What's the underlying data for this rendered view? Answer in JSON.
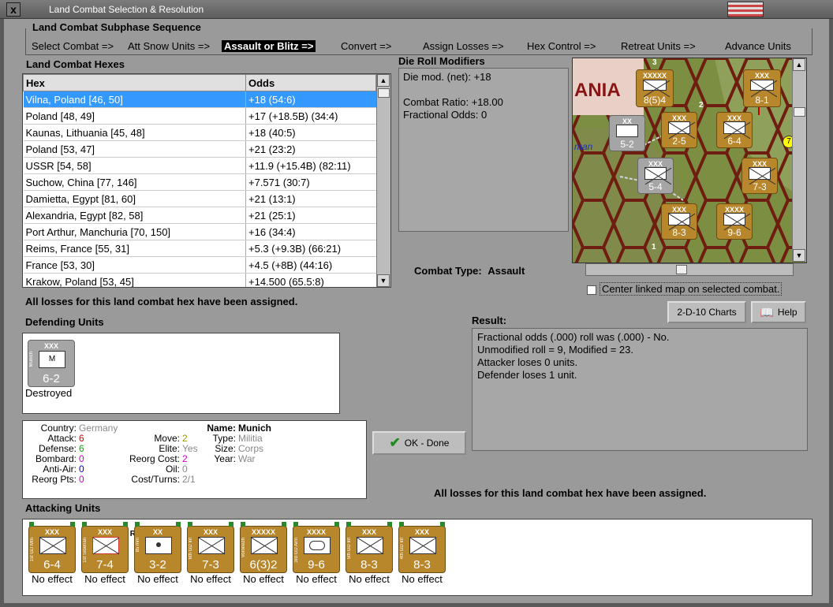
{
  "window": {
    "title": "Land Combat Selection & Resolution",
    "close_label": "x"
  },
  "sequence": {
    "label": "Land Combat Subphase Sequence",
    "steps": [
      "Select Combat =>",
      "Att Snow Units =>",
      "Assault or Blitz =>",
      "Convert =>",
      "Assign Losses =>",
      "Hex Control =>",
      "Retreat Units =>",
      "Advance Units"
    ]
  },
  "hexes": {
    "label": "Land Combat Hexes",
    "columns": [
      "Hex",
      "Odds"
    ],
    "rows": [
      [
        "Vilna, Poland [46, 50]",
        "+18 (54:6)"
      ],
      [
        "Poland [48, 49]",
        "+17 (+18.5B) (34:4)"
      ],
      [
        "Kaunas, Lithuania [45, 48]",
        "+18 (40:5)"
      ],
      [
        "Poland [53, 47]",
        "+21 (23:2)"
      ],
      [
        "USSR [54, 58]",
        "+11.9 (+15.4B) (82:11)"
      ],
      [
        "Suchow, China [77, 146]",
        "+7.571 (30:7)"
      ],
      [
        "Damietta, Egypt [81, 60]",
        "+21 (13:1)"
      ],
      [
        "Alexandria, Egypt [82, 58]",
        "+21 (25:1)"
      ],
      [
        "Port Arthur, Manchuria [70, 150]",
        "+16 (34:4)"
      ],
      [
        "Reims, France [55, 31]",
        "+5.3 (+9.3B) (66:21)"
      ],
      [
        "France [53, 30]",
        "+4.5 (+8B) (44:16)"
      ],
      [
        "Krakow, Poland [53, 45]",
        "+14.500 (65.5:8)"
      ]
    ]
  },
  "die_roll": {
    "label": "Die Roll Modifiers",
    "lines": [
      "Die mod. (net): +18",
      "",
      "Combat Ratio: +18.00",
      "Fractional Odds: 0"
    ]
  },
  "combat_type": {
    "label": "Combat Type:",
    "value": "Assault"
  },
  "center_map_label": "Center linked map on selected combat.",
  "losses_assigned_text": "All losses for this land combat hex have been assigned.",
  "buttons": {
    "charts": "2-D-10 Charts",
    "help": "Help",
    "ok": "OK - Done"
  },
  "result": {
    "label": "Result:",
    "lines": [
      "Fractional odds (.000) roll was (.000)  - No.",
      "Unmodified roll = 9, Modified = 23.",
      "Attacker loses 0 units.",
      "Defender loses 1 unit."
    ]
  },
  "defending": {
    "label": "Defending Units",
    "units": [
      {
        "size": "XXX",
        "strength": "6-2",
        "status": "Destroyed",
        "side_text": "Munich"
      }
    ]
  },
  "unit_info": {
    "country_label": "Country:",
    "country": "Germany",
    "attack_label": "Attack:",
    "attack": "6",
    "defense_label": "Defense:",
    "defense": "6",
    "bombard_label": "Bombard:",
    "bombard": "0",
    "antiair_label": "Anti-Air:",
    "antiair": "0",
    "reorg_label": "Reorg Pts:",
    "reorg": "0",
    "move_label": "Move:",
    "move": "2",
    "elite_label": "Elite:",
    "elite": "Yes",
    "reorgcost_label": "Reorg Cost:",
    "reorgcost": "2",
    "oil_label": "Oil:",
    "oil": "0",
    "cost_label": "Cost/Turns:",
    "cost": "2/1",
    "name_label": "Name:",
    "name": "Munich",
    "type_label": "Type:",
    "type": "Militia",
    "size_label": "Size:",
    "size": "Corps",
    "year_label": "Year:",
    "year": "War"
  },
  "attacking": {
    "label": "Attacking Units",
    "units": [
      {
        "size": "XXX",
        "strength": "6-4",
        "status": "No effect",
        "side_text": "1st GD Mtn"
      },
      {
        "size": "XXX",
        "strength": "7-4",
        "status": "No effect",
        "side_text": "1st Siberian"
      },
      {
        "size": "XX",
        "strength": "3-2",
        "status": "No effect",
        "side_text": "85 mm"
      },
      {
        "size": "XXX",
        "strength": "7-3",
        "status": "No effect",
        "side_text": "6th GD Inf"
      },
      {
        "size": "XXXXX",
        "strength": "6(3)2",
        "status": "No effect",
        "side_text": "Voronezh"
      },
      {
        "size": "XXXX",
        "strength": "9-6",
        "status": "No effect",
        "side_text": "3rd GD Arm"
      },
      {
        "size": "XXX",
        "strength": "8-3",
        "status": "No effect",
        "side_text": "5th GD Inf"
      },
      {
        "size": "XXX",
        "strength": "8-3",
        "status": "No effect",
        "side_text": "4th GD Inf"
      }
    ]
  },
  "map": {
    "labels": [
      "ANIA",
      "man"
    ],
    "counters": [
      "8(5)4",
      "8-1",
      "5-2",
      "2-5",
      "6-4",
      "5-4",
      "7-3",
      "8-3",
      "9-6"
    ],
    "sizes": [
      "XXXXX",
      "XXX",
      "XX",
      "XXX",
      "XXX",
      "XXX",
      "XXX",
      "XXXX"
    ],
    "badges": [
      "3",
      "2",
      "1",
      "7"
    ]
  },
  "colors": {
    "counter": "#b8862b",
    "selected": "#3399ff",
    "panel": "#9a9a9a"
  }
}
